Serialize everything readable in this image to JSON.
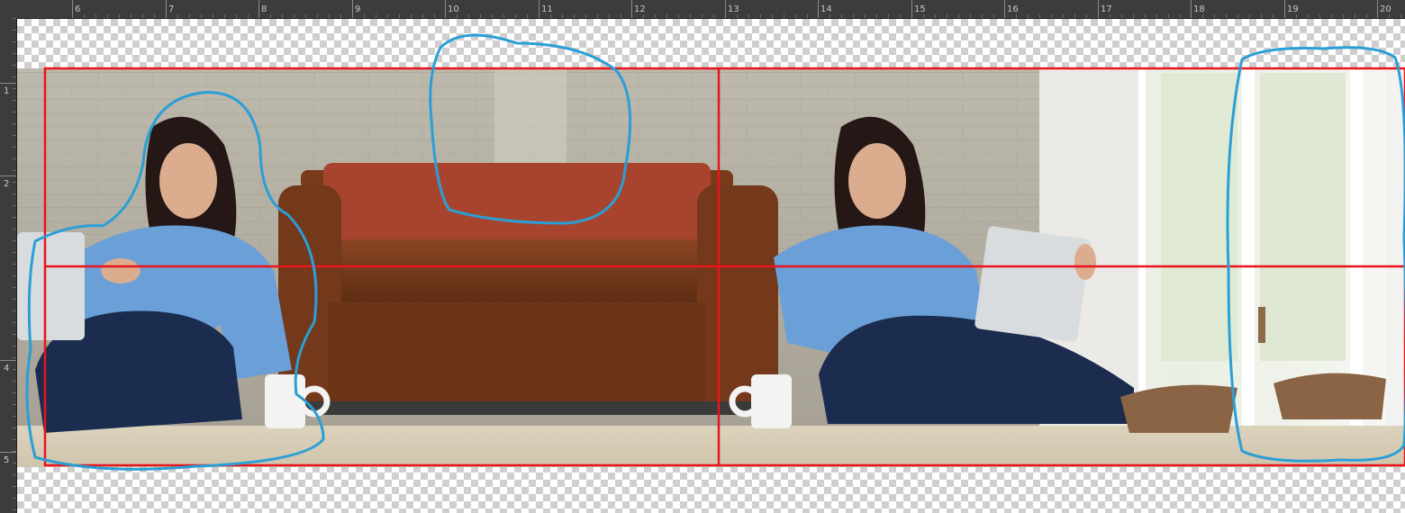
{
  "rulers": {
    "top_labels": [
      "6",
      "7",
      "8",
      "9",
      "10",
      "11",
      "12",
      "13",
      "14",
      "15",
      "16",
      "17",
      "18",
      "19",
      "20"
    ],
    "left_labels": [
      "1",
      "2",
      "4",
      "5"
    ]
  },
  "document": {
    "description_icons": [
      "woman-with-laptop-left",
      "sofa",
      "coffee-mug-left",
      "woman-with-laptop-right",
      "coffee-mug-right",
      "window-door"
    ],
    "guide_color": "#e8151d",
    "annotation_color": "#2a9fd6",
    "sofa_color": "#7a3b1c",
    "blanket_color": "#a8442e",
    "shirt_color": "#6a9fd8",
    "jeans_color": "#1b2c4f"
  }
}
